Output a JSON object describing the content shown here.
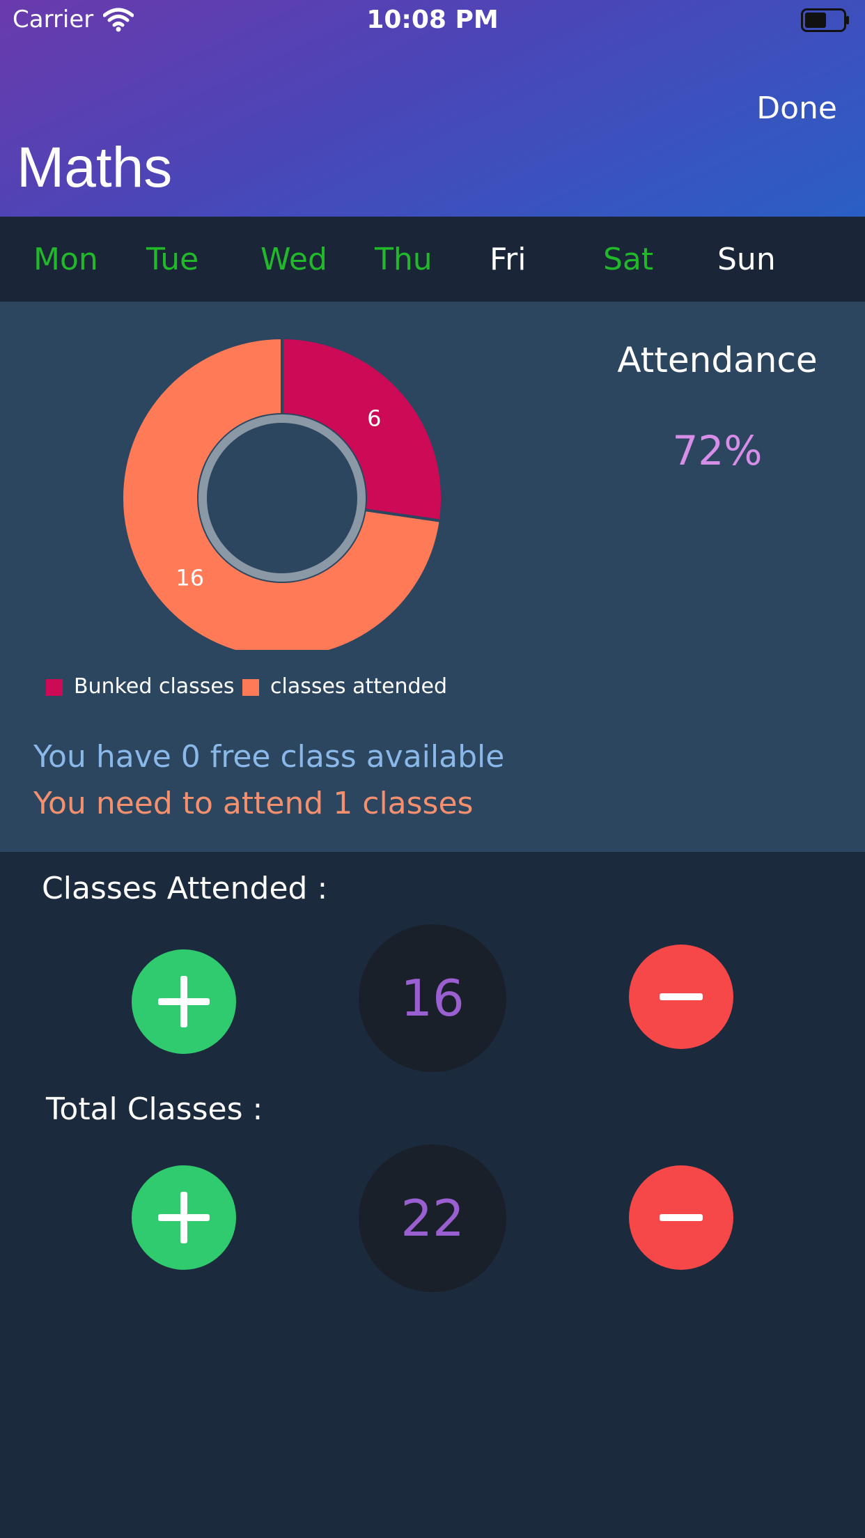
{
  "status_bar": {
    "carrier": "Carrier",
    "time": "10:08 PM"
  },
  "header": {
    "done_label": "Done",
    "title": "Maths"
  },
  "days": [
    {
      "label": "Mon",
      "color": "#21b82a"
    },
    {
      "label": "Tue",
      "color": "#21b82a"
    },
    {
      "label": "Wed",
      "color": "#21b82a"
    },
    {
      "label": "Thu",
      "color": "#21b82a"
    },
    {
      "label": "Fri",
      "color": "#ffffff"
    },
    {
      "label": "Sat",
      "color": "#21b82a"
    },
    {
      "label": "Sun",
      "color": "#ffffff"
    }
  ],
  "attendance": {
    "label": "Attendance",
    "value": "72%"
  },
  "chart_data": {
    "type": "pie",
    "variant": "donut",
    "categories": [
      "Bunked classes",
      "classes attended"
    ],
    "values": [
      6,
      16
    ],
    "colors": [
      "#cc0a55",
      "#ff7a56"
    ],
    "data_labels": [
      "6",
      "16"
    ],
    "legend_position": "bottom-left"
  },
  "messages": {
    "free_classes": "You have 0 free class available",
    "need_attend": "You need to attend 1 classes"
  },
  "classes_attended": {
    "label": "Classes Attended :",
    "value": "16"
  },
  "total_classes": {
    "label": "Total Classes :",
    "value": "22"
  },
  "icons": {
    "add": "plus-icon",
    "remove": "minus-icon"
  }
}
